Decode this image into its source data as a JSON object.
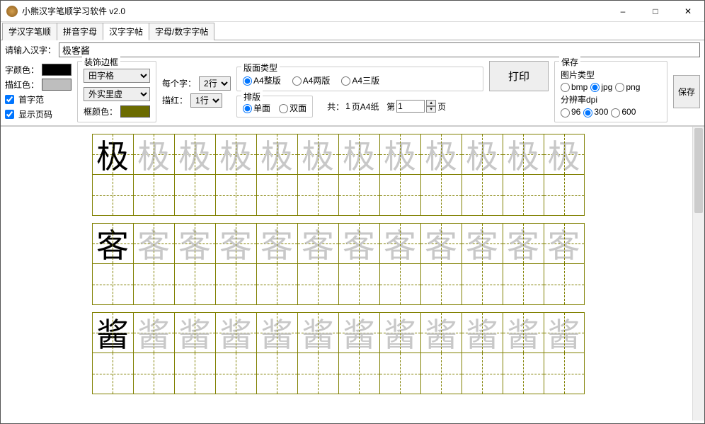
{
  "window": {
    "title": "小熊汉字笔顺学习软件 v2.0"
  },
  "tabs": {
    "items": [
      "学汉字笔顺",
      "拼音字母",
      "汉字字帖",
      "字母/数字字帖"
    ],
    "active": 2
  },
  "inputRow": {
    "label": "请输入汉字：",
    "value": "极客酱"
  },
  "colors": {
    "char_label": "字颜色：",
    "char": "#000000",
    "trace_label": "描红色：",
    "trace": "#BEBEBE"
  },
  "checks": {
    "first_char": "首字范",
    "show_page": "显示页码"
  },
  "frame": {
    "group": "装饰边框",
    "style_value": "田字格",
    "border_value": "外实里虚",
    "framecolor_label": "框颜色：",
    "framecolor": "#6B6B00"
  },
  "perchar": {
    "lbl_lines": "每个字：",
    "lines_val": "2行",
    "lbl_trace": "描红：",
    "trace_val": "1行"
  },
  "layout": {
    "group_type": "版面类型",
    "opt_full": "A4整版",
    "opt_two": "A4两版",
    "opt_three": "A4三版",
    "group_side": "排版",
    "opt_single": "单面",
    "opt_double": "双面",
    "pages_prefix": "共：",
    "pages_mid": "页A4纸",
    "pages_count": "1",
    "page_lbl": "第",
    "page_num": "1",
    "page_suffix": "页"
  },
  "print": {
    "btn": "打印"
  },
  "save": {
    "group": "保存",
    "imgtype": "图片类型",
    "bmp": "bmp",
    "jpg": "jpg",
    "png": "png",
    "dpi": "分辨率dpi",
    "d96": "96",
    "d300": "300",
    "d600": "600",
    "btn": "保存"
  },
  "sheet": {
    "chars": [
      "极",
      "客",
      "酱"
    ],
    "cols": 12
  }
}
